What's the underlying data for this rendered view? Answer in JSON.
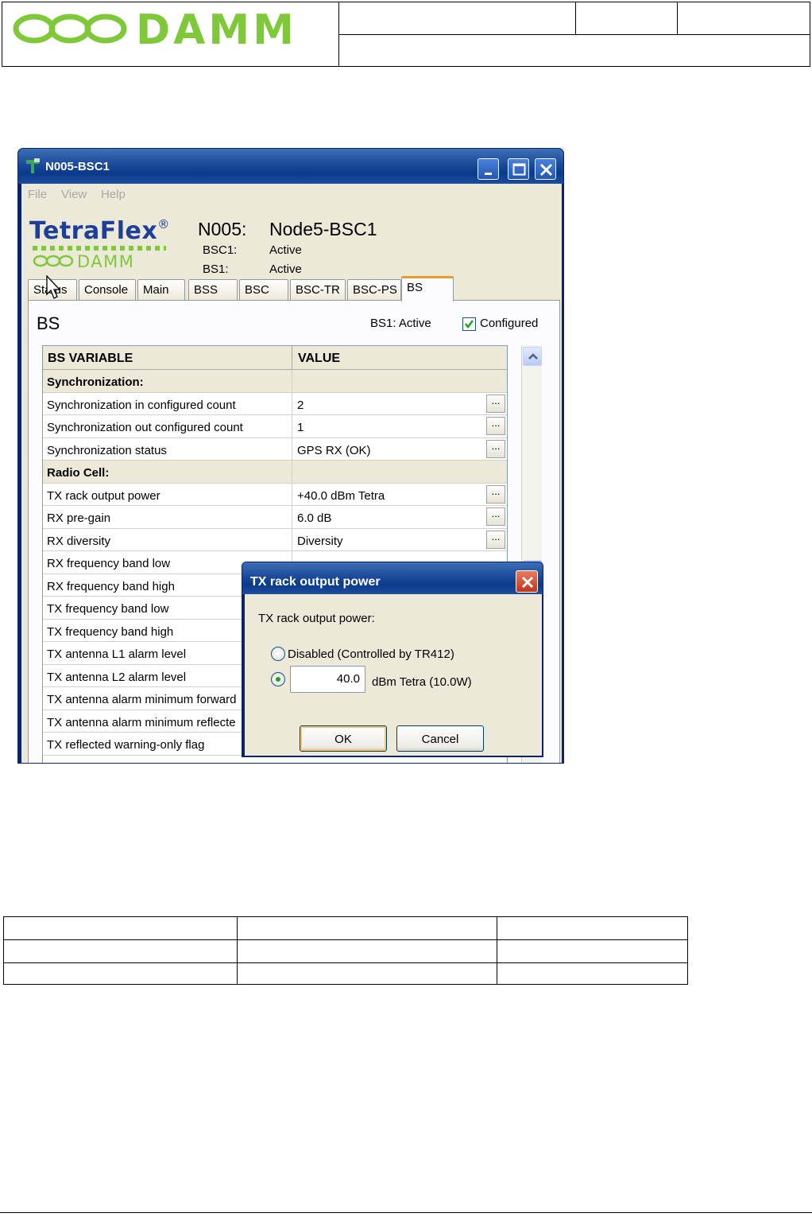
{
  "doc_header": {
    "logo_text": "DAMM",
    "logo_color": "#7ec83a"
  },
  "window": {
    "title": "N005-BSC1",
    "menu": [
      "File",
      "View",
      "Help"
    ],
    "brand": {
      "product": "TetraFlex",
      "registered": "®",
      "maker": "DAMM"
    },
    "node_id": "N005:",
    "node_name": "Node5-BSC1",
    "status_lines": [
      {
        "label": "BSC1:",
        "value": "Active"
      },
      {
        "label": "BS1:",
        "value": "Active"
      }
    ],
    "tabs": [
      "Status",
      "Console",
      "Main",
      "BSS",
      "BSC",
      "BSC-TR",
      "BSC-PS",
      "BS"
    ],
    "active_tab": "BS",
    "panel": {
      "title": "BS",
      "status": "BS1: Active",
      "configured_label": "Configured",
      "configured_checked": true
    },
    "grid": {
      "headers": [
        "BS VARIABLE",
        "VALUE"
      ],
      "button_label": "...",
      "rows": [
        {
          "variable": "Synchronization:",
          "value": "",
          "section": true
        },
        {
          "variable": "Synchronization in configured count",
          "value": "2"
        },
        {
          "variable": "Synchronization out configured count",
          "value": "1"
        },
        {
          "variable": "Synchronization status",
          "value": "GPS RX (OK)"
        },
        {
          "variable": "Radio Cell:",
          "value": "",
          "section": true
        },
        {
          "variable": "TX rack output power",
          "value": "+40.0 dBm Tetra"
        },
        {
          "variable": "RX pre-gain",
          "value": "6.0 dB"
        },
        {
          "variable": "RX diversity",
          "value": "Diversity"
        },
        {
          "variable": "RX frequency band low",
          "value": ""
        },
        {
          "variable": "RX frequency band high",
          "value": ""
        },
        {
          "variable": "TX frequency band low",
          "value": ""
        },
        {
          "variable": "TX frequency band high",
          "value": ""
        },
        {
          "variable": "TX antenna L1 alarm level",
          "value": ""
        },
        {
          "variable": "TX antenna L2 alarm level",
          "value": ""
        },
        {
          "variable": "TX antenna alarm minimum forward",
          "value": ""
        },
        {
          "variable": "TX antenna alarm minimum reflecte",
          "value": ""
        },
        {
          "variable": "TX reflected warning-only flag",
          "value": ""
        }
      ]
    }
  },
  "dialog": {
    "title": "TX rack output power",
    "prompt": "TX rack output power:",
    "option_disabled": "Disabled (Controlled by TR412)",
    "option_value_unit": "dBm Tetra (10.0W)",
    "value": "40.0",
    "selected_option": "value",
    "ok_label": "OK",
    "cancel_label": "Cancel"
  },
  "colors": {
    "titlebar": "#0b3a8a",
    "brand_blue": "#1d3f9a",
    "brand_green": "#7ec83a",
    "active_tab_accent": "#e69d2b"
  }
}
